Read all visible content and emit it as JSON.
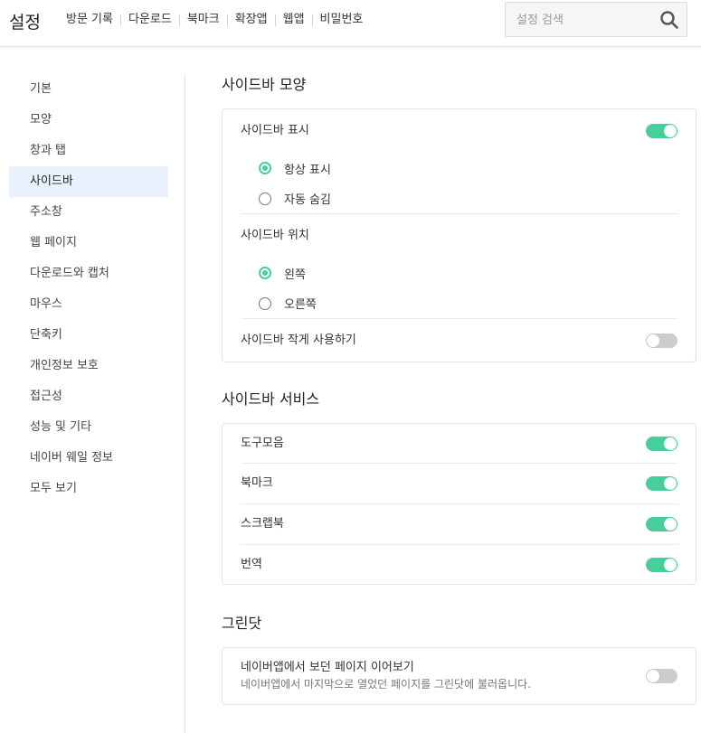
{
  "header": {
    "title": "설정",
    "nav": [
      "방문 기록",
      "다운로드",
      "북마크",
      "확장앱",
      "웹앱",
      "비밀번호"
    ],
    "search_placeholder": "설정 검색"
  },
  "sidebar": {
    "items": [
      "기본",
      "모양",
      "창과 탭",
      "사이드바",
      "주소창",
      "웹 페이지",
      "다운로드와 캡처",
      "마우스",
      "단축키",
      "개인정보 보호",
      "접근성",
      "성능 및 기타",
      "네이버 웨일 정보",
      "모두 보기"
    ],
    "active": "사이드바"
  },
  "sections": {
    "appearance": {
      "title": "사이드바 모양",
      "show_sidebar": {
        "label": "사이드바 표시",
        "enabled": true
      },
      "display_options": [
        {
          "label": "항상 표시",
          "checked": true
        },
        {
          "label": "자동 숨김",
          "checked": false
        }
      ],
      "position": {
        "label": "사이드바 위치",
        "options": [
          {
            "label": "왼쪽",
            "checked": true
          },
          {
            "label": "오른쪽",
            "checked": false
          }
        ]
      },
      "compact": {
        "label": "사이드바 작게 사용하기",
        "enabled": false
      }
    },
    "services": {
      "title": "사이드바 서비스",
      "items": [
        {
          "label": "도구모음",
          "enabled": true
        },
        {
          "label": "북마크",
          "enabled": true
        },
        {
          "label": "스크랩북",
          "enabled": true
        },
        {
          "label": "번역",
          "enabled": true
        }
      ]
    },
    "greendot": {
      "title": "그린닷",
      "continue": {
        "label": "네이버앱에서 보던 페이지 이어보기",
        "desc": "네이버앱에서 마지막으로 열었던 페이지를 그린닷에 불러옵니다.",
        "enabled": false
      }
    }
  },
  "colors": {
    "accent": "#47cf9b",
    "active_bg": "#e8f1fc",
    "toggle_off": "#cccccc"
  }
}
